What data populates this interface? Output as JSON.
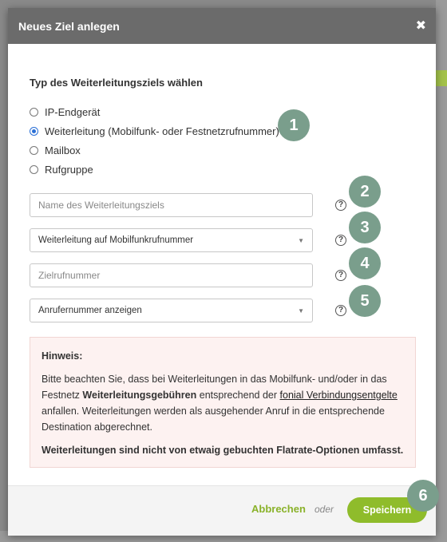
{
  "modal": {
    "title": "Neues Ziel anlegen",
    "close_label": "✖"
  },
  "target_type": {
    "title": "Typ des Weiterleitungsziels wählen",
    "options": [
      {
        "label": "IP-Endgerät",
        "checked": false
      },
      {
        "label": "Weiterleitung (Mobilfunk- oder Festnetzrufnummer)",
        "checked": true
      },
      {
        "label": "Mailbox",
        "checked": false
      },
      {
        "label": "Rufgruppe",
        "checked": false
      }
    ]
  },
  "form": {
    "name_placeholder": "Name des Weiterleitungsziels",
    "forward_type_value": "Weiterleitung auf Mobilfunkrufnummer",
    "target_number_placeholder": "Zielrufnummer",
    "caller_id_value": "Anrufernummer anzeigen",
    "help_label": "?"
  },
  "steps": [
    "1",
    "2",
    "3",
    "4",
    "5",
    "6"
  ],
  "notice": {
    "title": "Hinweis:",
    "p1_a": "Bitte beachten Sie, dass bei Weiterleitungen in das Mobilfunk- und/oder in das Festnetz ",
    "p1_bold": "Weiterleitungsgebühren",
    "p1_b": " entsprechend der ",
    "p1_link": "fonial Verbindungsentgelte",
    "p1_c": " anfallen. Weiterleitungen werden als ausgehender Anruf in die entsprechende Destination abgerechnet.",
    "p2": "Weiterleitungen sind nicht von etwaig gebuchten Flatrate-Optionen umfasst."
  },
  "footer": {
    "cancel_label": "Abbrechen",
    "or_label": "oder",
    "save_label": "Speichern"
  },
  "colors": {
    "header_bg": "#6b6b6b",
    "step_badge": "#7a9e8c",
    "accent_green": "#8fbc2b",
    "notice_bg": "#fdf2f1"
  }
}
